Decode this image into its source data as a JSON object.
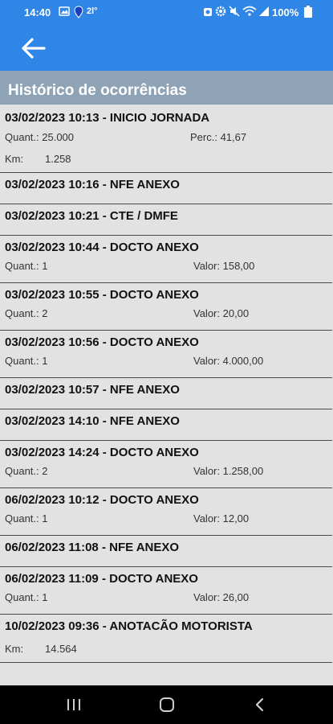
{
  "status_bar": {
    "time": "14:40",
    "temperature": "2l°",
    "battery": "100%",
    "icons": [
      "image-icon",
      "location-icon",
      "alarm-icon",
      "settings-icon",
      "mute-icon",
      "wifi-icon",
      "signal-icon",
      "battery-icon"
    ]
  },
  "app_bar": {
    "back_icon": "arrow-left-icon"
  },
  "header": {
    "title": "Histórico de ocorrências"
  },
  "items": [
    {
      "title": "03/02/2023 10:13 - INICIO JORNADA",
      "line1_left": "Quant.: 25.000",
      "line1_right": "Perc.: 41,67",
      "line2_label": "Km:",
      "line2_value": "1.258"
    },
    {
      "title": "03/02/2023 10:16 - NFE ANEXO"
    },
    {
      "title": "03/02/2023 10:21 - CTE / DMFE"
    },
    {
      "title": "03/02/2023 10:44 - DOCTO ANEXO",
      "line1_left": "Quant.: 1",
      "line1_right": "Valor: 158,00"
    },
    {
      "title": "03/02/2023 10:55 - DOCTO ANEXO",
      "line1_left": "Quant.: 2",
      "line1_right": "Valor: 20,00"
    },
    {
      "title": "03/02/2023 10:56 - DOCTO ANEXO",
      "line1_left": "Quant.: 1",
      "line1_right": "Valor: 4.000,00"
    },
    {
      "title": "03/02/2023 10:57 - NFE ANEXO"
    },
    {
      "title": "03/02/2023 14:10 - NFE ANEXO"
    },
    {
      "title": "03/02/2023 14:24 - DOCTO ANEXO",
      "line1_left": "Quant.: 2",
      "line1_right": "Valor: 1.258,00"
    },
    {
      "title": "06/02/2023 10:12 - DOCTO ANEXO",
      "line1_left": "Quant.: 1",
      "line1_right": "Valor: 12,00"
    },
    {
      "title": "06/02/2023 11:08 - NFE ANEXO"
    },
    {
      "title": "06/02/2023 11:09 - DOCTO ANEXO",
      "line1_left": "Quant.: 1",
      "line1_right": "Valor: 26,00"
    },
    {
      "title": "10/02/2023 09:36 - ANOTACÃO MOTORISTA",
      "line2_label": "Km:",
      "line2_value": "14.564"
    }
  ],
  "nav_bar": {
    "icons": [
      "recent-apps-icon",
      "home-icon",
      "back-icon"
    ]
  }
}
